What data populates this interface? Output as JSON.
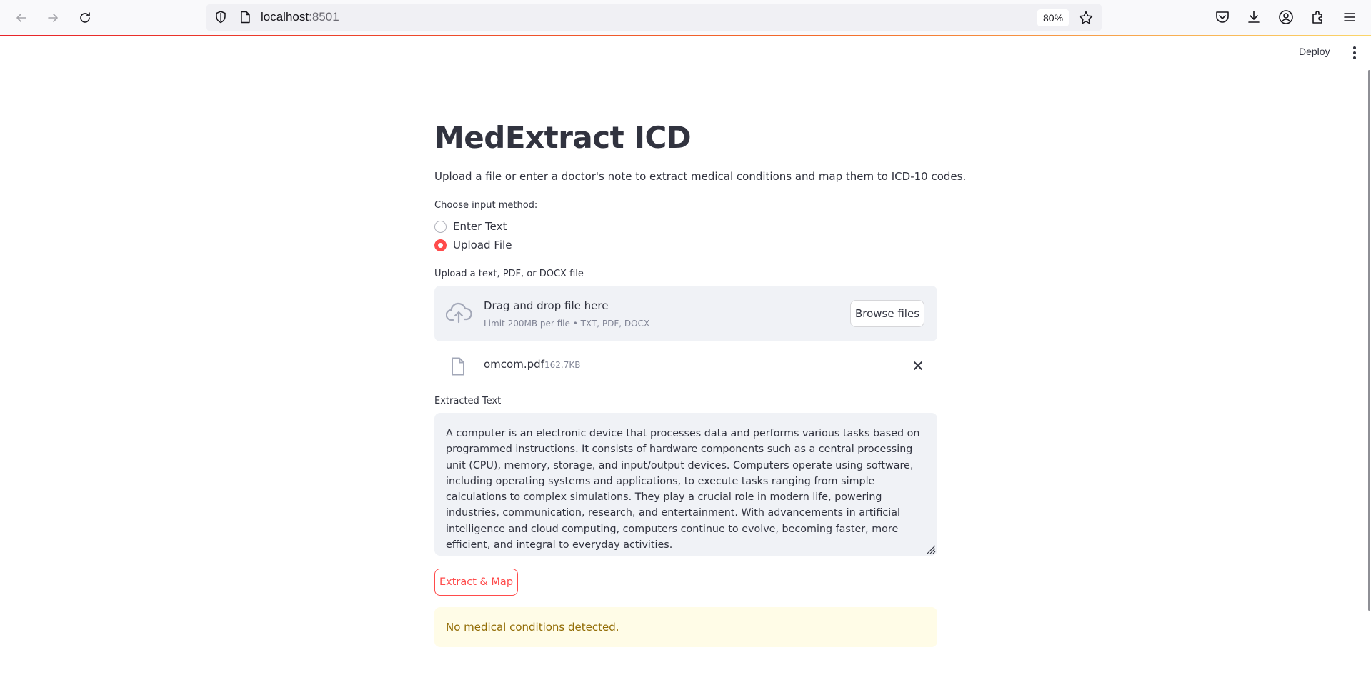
{
  "browser": {
    "url_host": "localhost",
    "url_port": ":8501",
    "zoom": "80%"
  },
  "header": {
    "deploy_label": "Deploy"
  },
  "main": {
    "title": "MedExtract ICD",
    "description": "Upload a file or enter a doctor's note to extract medical conditions and map them to ICD-10 codes.",
    "input_method_label": "Choose input method:",
    "radio_options": [
      {
        "label": "Enter Text",
        "selected": false
      },
      {
        "label": "Upload File",
        "selected": true
      }
    ],
    "upload_label": "Upload a text, PDF, or DOCX file",
    "dropzone": {
      "title": "Drag and drop file here",
      "limit": "Limit 200MB per file • TXT, PDF, DOCX",
      "browse_label": "Browse files"
    },
    "uploaded_file": {
      "name": "omcom.pdf",
      "size": "162.7KB"
    },
    "extracted_label": "Extracted Text",
    "extracted_text": "A computer is an electronic device that processes data and performs various tasks based on programmed instructions. It consists of hardware components such as a central processing unit (CPU), memory, storage, and input/output devices. Computers operate using software, including operating systems and applications, to execute tasks ranging from simple calculations to complex simulations. They play a crucial role in modern life, powering industries, communication, research, and entertainment. With advancements in artificial intelligence and cloud computing, computers continue to evolve, becoming faster, more efficient, and integral to everyday activities.",
    "extract_button": "Extract & Map",
    "alert": "No medical conditions detected."
  },
  "colors": {
    "accent": "#ff4b4b",
    "alert_bg": "#fffce7",
    "alert_text": "#926c05",
    "panel_bg": "#f0f2f6"
  }
}
